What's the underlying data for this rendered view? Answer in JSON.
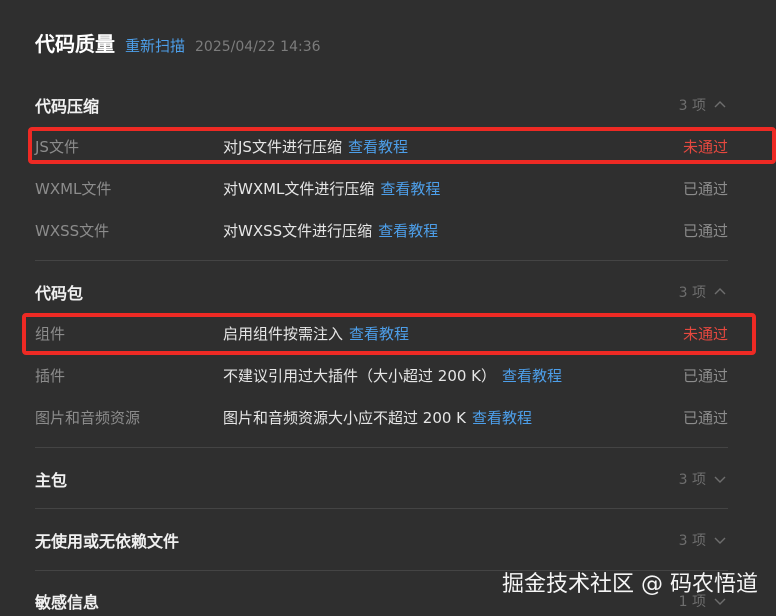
{
  "header": {
    "title": "代码质量",
    "rescan_label": "重新扫描",
    "timestamp": "2025/04/22 14:36"
  },
  "sections": [
    {
      "title": "代码压缩",
      "count": "3 项",
      "expanded": true,
      "rows": [
        {
          "name": "JS文件",
          "desc": "对JS文件进行压缩",
          "link": "查看教程",
          "status": "未通过",
          "passed": false
        },
        {
          "name": "WXML文件",
          "desc": "对WXML文件进行压缩",
          "link": "查看教程",
          "status": "已通过",
          "passed": true
        },
        {
          "name": "WXSS文件",
          "desc": "对WXSS文件进行压缩",
          "link": "查看教程",
          "status": "已通过",
          "passed": true
        }
      ]
    },
    {
      "title": "代码包",
      "count": "3 项",
      "expanded": true,
      "rows": [
        {
          "name": "组件",
          "desc": "启用组件按需注入",
          "link": "查看教程",
          "status": "未通过",
          "passed": false
        },
        {
          "name": "插件",
          "desc": "不建议引用过大插件（大小超过 200 K）",
          "link": "查看教程",
          "status": "已通过",
          "passed": true
        },
        {
          "name": "图片和音频资源",
          "desc": "图片和音频资源大小应不超过 200 K",
          "link": "查看教程",
          "status": "已通过",
          "passed": true
        }
      ]
    },
    {
      "title": "主包",
      "count": "3 项",
      "expanded": false
    },
    {
      "title": "无使用或无依赖文件",
      "count": "3 项",
      "expanded": false
    },
    {
      "title": "敏感信息",
      "count": "1 项",
      "expanded": false
    }
  ],
  "watermark": "掘金技术社区 @ 码农悟道",
  "colors": {
    "background": "#2f2f2f",
    "link": "#4d9fea",
    "fail": "#e5483f",
    "highlight_border": "#ee2a24"
  }
}
